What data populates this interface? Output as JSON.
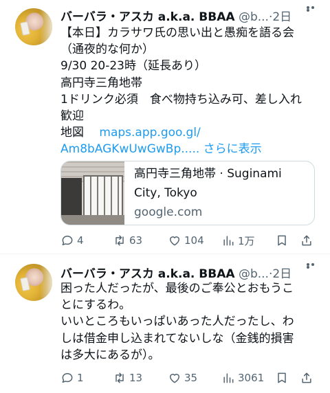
{
  "tweets": [
    {
      "author_name": "バーバラ・アスカ a.k.a. BBAA",
      "handle": "@b...",
      "separator": "·",
      "time": "2日",
      "body_lines": [
        "【本日】カラサワ氏の思い出と愚痴を語る会",
        "（通夜的な何か）",
        "9/30 20-23時（延長あり）",
        "高円寺三角地帯",
        "1ドリンク必須　食べ物持ち込み可、差し入れ",
        "歓迎"
      ],
      "map_label": "地図",
      "link_line1": "maps.app.goo.gl/",
      "link_line2": "Am8bAGKwUwGwBp.....",
      "show_more": "さらに表示",
      "card": {
        "title_line1": "高円寺三角地帯 · Suginami",
        "title_line2": "City, Tokyo",
        "domain": "google.com"
      },
      "actions": {
        "replies": "4",
        "reposts": "63",
        "likes": "104",
        "views": "1万"
      }
    },
    {
      "author_name": "バーバラ・アスカ a.k.a. BBAA",
      "handle": "@b...",
      "separator": "·",
      "time": "2日",
      "body_lines": [
        "困った人だったが、最後のご奉公とおもうこ",
        "とにするわ。",
        "いいところもいっぱいあった人だったし、わ",
        "しは借金申し込まれてないしな（金銭的損害",
        "は多大にあるが）。"
      ],
      "actions": {
        "replies": "1",
        "reposts": "13",
        "likes": "35",
        "views": "3061"
      }
    }
  ],
  "colors": {
    "text": "#0f1419",
    "secondary": "#536471",
    "link": "#1d9bf0",
    "border": "#cfd9de"
  }
}
